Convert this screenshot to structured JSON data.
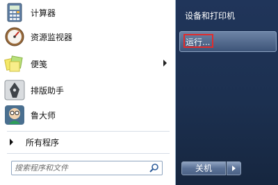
{
  "programs": [
    {
      "label": "计算器",
      "icon": "calculator-icon"
    },
    {
      "label": "资源监视器",
      "icon": "resource-monitor-icon"
    },
    {
      "label": "便笺",
      "icon": "sticky-notes-icon"
    },
    {
      "label": "排版助手",
      "icon": "typesetting-assistant-icon"
    },
    {
      "label": "鲁大师",
      "icon": "ludashi-icon"
    }
  ],
  "all_programs_label": "所有程序",
  "search": {
    "placeholder": "搜索程序和文件",
    "value": ""
  },
  "right_menu": {
    "devices_printers": "设备和打印机",
    "run": "运行..."
  },
  "shutdown_label": "关机",
  "colors": {
    "highlight_border": "#e32b2b",
    "right_pane": "#1d3150"
  }
}
